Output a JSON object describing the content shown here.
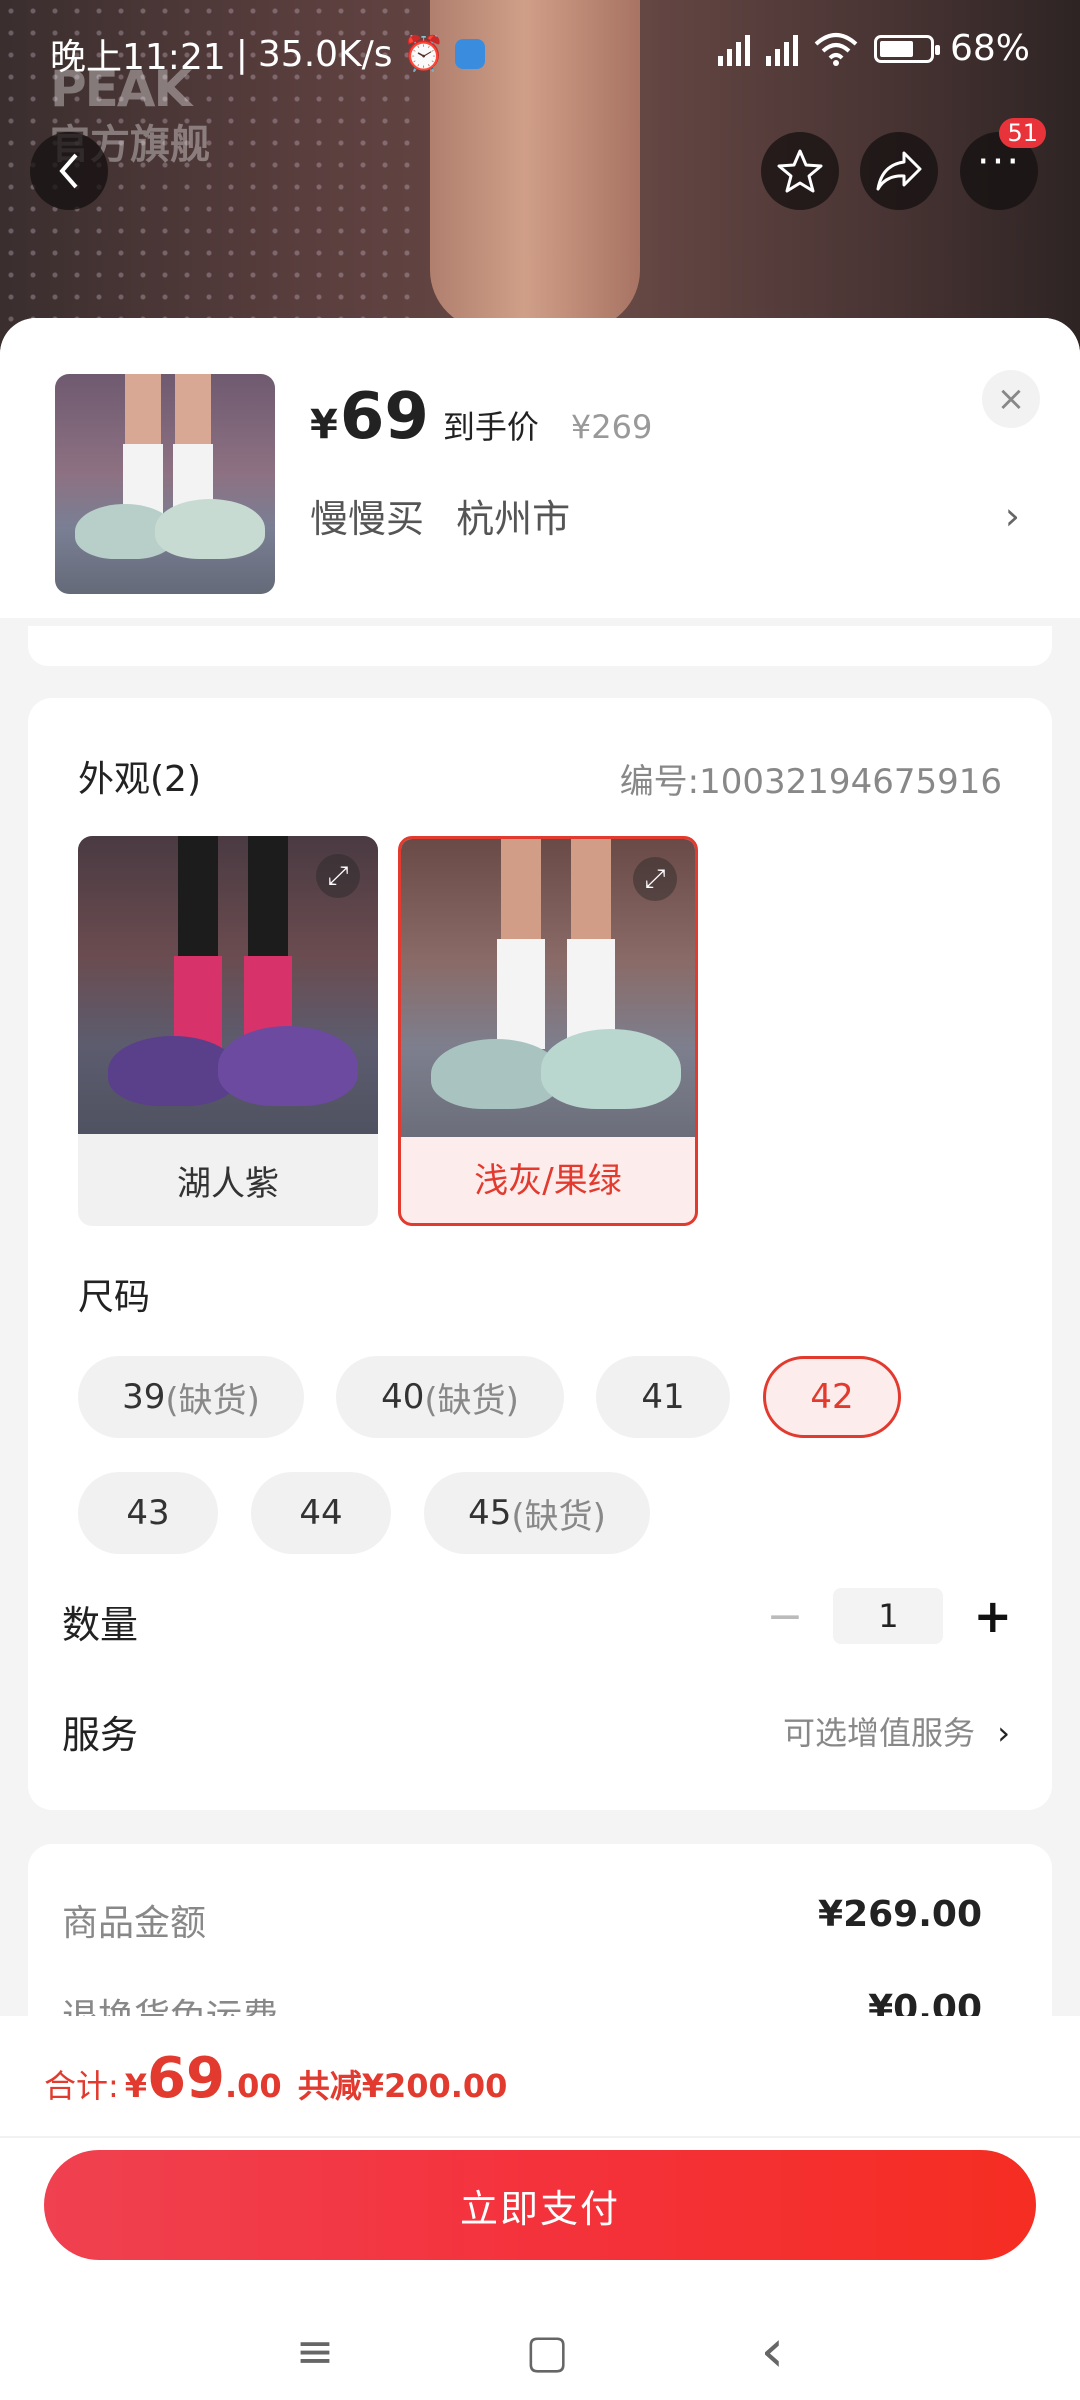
{
  "status_bar": {
    "time": "晚上11:21",
    "separator": "|",
    "speed": "35.0K/s",
    "battery_text": "68%",
    "battery_level": 0.68
  },
  "hero": {
    "logo_text": "PEAK",
    "store_text": "官方旗舰"
  },
  "top_buttons": {
    "back_icon": "chevron-left-icon",
    "favorite_icon": "star-icon",
    "share_icon": "share-icon",
    "more_icon": "more-icon",
    "more_badge": "51"
  },
  "header": {
    "currency": "¥",
    "price": "69",
    "price_label": "到手价",
    "original_price": "¥269",
    "address_name": "慢慢买",
    "address_city": "杭州市",
    "close_icon": "×",
    "chevron": "›"
  },
  "appearance": {
    "title": "外观(2)",
    "sku": "编号:10032194675916",
    "options": [
      {
        "label": "湖人紫",
        "selected": false
      },
      {
        "label": "浅灰/果绿",
        "selected": true
      }
    ]
  },
  "sizes": {
    "title": "尺码",
    "options": [
      {
        "num": "39",
        "note": "(缺货)",
        "selected": false
      },
      {
        "num": "40",
        "note": "(缺货)",
        "selected": false
      },
      {
        "num": "41",
        "note": "",
        "selected": false
      },
      {
        "num": "42",
        "note": "",
        "selected": true
      },
      {
        "num": "43",
        "note": "",
        "selected": false
      },
      {
        "num": "44",
        "note": "",
        "selected": false
      },
      {
        "num": "45",
        "note": "(缺货)",
        "selected": false
      }
    ]
  },
  "quantity": {
    "label": "数量",
    "minus": "−",
    "value": "1",
    "plus": "+"
  },
  "service": {
    "label": "服务",
    "value": "可选增值服务",
    "chevron": "›"
  },
  "amounts": {
    "goods_label": "商品金额",
    "goods_value": "¥269.00",
    "freight_label": "退换货免运费",
    "freight_value": "¥0.00"
  },
  "total": {
    "label": "合计: ",
    "currency": "¥",
    "integer": "69",
    "cents": ".00",
    "saving": "共减¥200.00"
  },
  "pay_button": "立即支付",
  "nav_bar": {
    "menu": "≡",
    "home": "▢",
    "back": "‹"
  },
  "colors": {
    "accent": "#e23a2e",
    "pay_button": "#f4323c"
  }
}
